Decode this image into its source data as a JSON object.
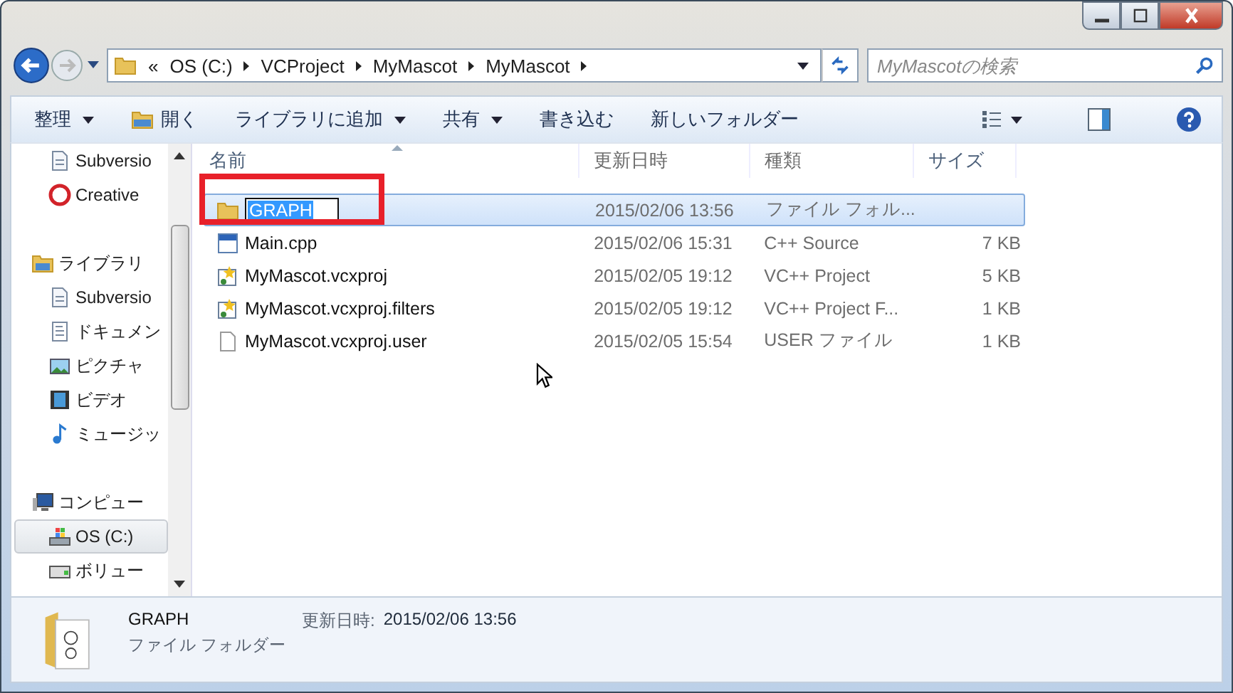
{
  "address_bar": {
    "crumbs": [
      "«",
      "OS (C:)",
      "VCProject",
      "MyMascot",
      "MyMascot"
    ]
  },
  "search": {
    "placeholder": "MyMascotの検索"
  },
  "toolbar": {
    "items": [
      {
        "label": "整理",
        "kind": "menu"
      },
      {
        "label": "開く",
        "kind": "icon"
      },
      {
        "label": "ライブラリに追加",
        "kind": "menu"
      },
      {
        "label": "共有",
        "kind": "menu"
      },
      {
        "label": "書き込む",
        "kind": "plain"
      },
      {
        "label": "新しいフォルダー",
        "kind": "plain"
      }
    ]
  },
  "sidebar": {
    "items": [
      {
        "label": "Subversio",
        "kind": "doc",
        "selected": false
      },
      {
        "label": "Creative",
        "kind": "cc",
        "selected": false
      },
      {
        "label": "ライブラリ",
        "kind": "library",
        "selected": false,
        "children": [
          {
            "label": "Subversio",
            "kind": "doc",
            "selected": false
          },
          {
            "label": "ドキュメン",
            "kind": "page",
            "selected": false
          },
          {
            "label": "ピクチャ",
            "kind": "picture",
            "selected": false
          },
          {
            "label": "ビデオ",
            "kind": "video",
            "selected": false
          },
          {
            "label": "ミュージッ",
            "kind": "music",
            "selected": false
          }
        ]
      },
      {
        "label": "コンピュー",
        "kind": "computer",
        "selected": false,
        "children": [
          {
            "label": "OS (C:)",
            "kind": "drive",
            "selected": true
          },
          {
            "label": "ボリュー",
            "kind": "volume",
            "selected": false
          }
        ]
      }
    ]
  },
  "table": {
    "columns": [
      "名前",
      "更新日時",
      "種類",
      "サイズ"
    ],
    "rows": [
      {
        "name": "GRAPH",
        "modified": "2015/02/06 13:56",
        "type": "ファイル フォル...",
        "size": "",
        "kind": "folder",
        "selected": true,
        "renaming": true,
        "annotated": true
      },
      {
        "name": "Main.cpp",
        "modified": "2015/02/06 15:31",
        "type": "C++ Source",
        "size": "7 KB",
        "kind": "cpp",
        "selected": false,
        "renaming": false,
        "annotated": false
      },
      {
        "name": "MyMascot.vcxproj",
        "modified": "2015/02/05 19:12",
        "type": "VC++ Project",
        "size": "5 KB",
        "kind": "proj",
        "selected": false,
        "renaming": false,
        "annotated": false
      },
      {
        "name": "MyMascot.vcxproj.filters",
        "modified": "2015/02/05 19:12",
        "type": "VC++ Project F...",
        "size": "1 KB",
        "kind": "proj",
        "selected": false,
        "renaming": false,
        "annotated": false
      },
      {
        "name": "MyMascot.vcxproj.user",
        "modified": "2015/02/05 15:54",
        "type": "USER ファイル",
        "size": "1 KB",
        "kind": "file",
        "selected": false,
        "renaming": false,
        "annotated": false
      }
    ]
  },
  "details": {
    "name": "GRAPH",
    "type": "ファイル フォルダー",
    "modified_label": "更新日時:",
    "modified": "2015/02/06 13:56"
  }
}
